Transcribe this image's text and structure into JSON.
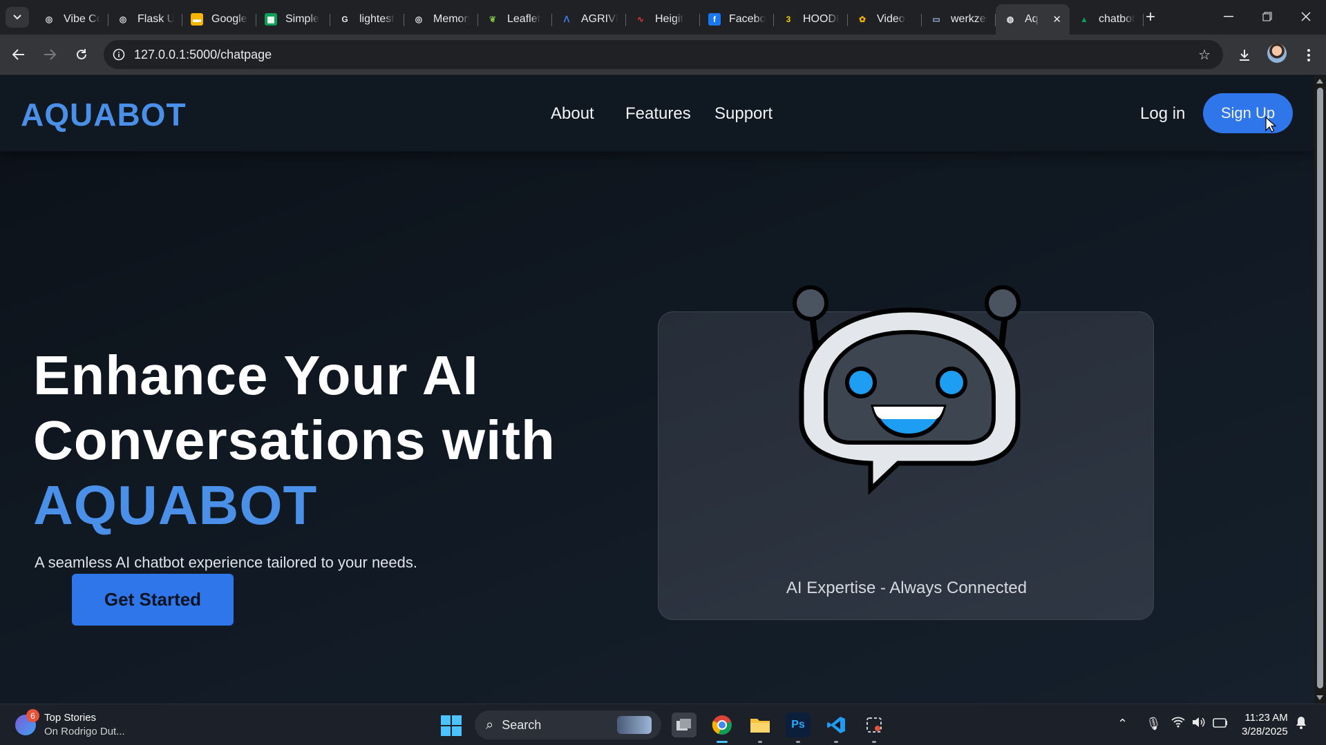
{
  "browser": {
    "tabs": [
      {
        "title": "Vibe Coding",
        "icon": "openai-icon"
      },
      {
        "title": "Flask UI",
        "icon": "openai-icon"
      },
      {
        "title": "Google Slides",
        "icon": "google-slides-icon"
      },
      {
        "title": "Simple",
        "icon": "google-sheets-icon"
      },
      {
        "title": "lightest",
        "icon": "google-icon"
      },
      {
        "title": "Memory",
        "icon": "openai-icon"
      },
      {
        "title": "Leaflet",
        "icon": "leaflet-icon"
      },
      {
        "title": "AGRIVE",
        "icon": "agrive-icon"
      },
      {
        "title": "Heigit",
        "icon": "heigit-icon"
      },
      {
        "title": "Facebook",
        "icon": "facebook-icon"
      },
      {
        "title": "HOODI",
        "icon": "hoodi-icon"
      },
      {
        "title": "Video",
        "icon": "photos-icon"
      },
      {
        "title": "werkzeug",
        "icon": "window-icon"
      },
      {
        "title": "Aq",
        "icon": "globe-icon",
        "active": true
      },
      {
        "title": "chatbot",
        "icon": "google-drive-icon"
      }
    ],
    "address": "127.0.0.1:5000/chatpage"
  },
  "site": {
    "brand": "AQUABOT",
    "nav": {
      "about": "About",
      "features": "Features",
      "support": "Support"
    },
    "login": "Log in",
    "signup": "Sign Up",
    "hero": {
      "line1": "Enhance Your AI",
      "line2": "Conversations with",
      "accent": "AQUABOT",
      "subtitle": "A seamless AI chatbot experience tailored to your needs.",
      "cta": "Get Started"
    },
    "card_caption": "AI Expertise - Always Connected"
  },
  "taskbar": {
    "widget_badge": "6",
    "widget_title": "Top Stories",
    "widget_subtitle": "On Rodrigo Dut...",
    "search_placeholder": "Search",
    "time": "11:23 AM",
    "date": "3/28/2025"
  },
  "colors": {
    "accent": "#4a8fe8",
    "button": "#2f76ea",
    "page_bg": "#0c1118"
  }
}
